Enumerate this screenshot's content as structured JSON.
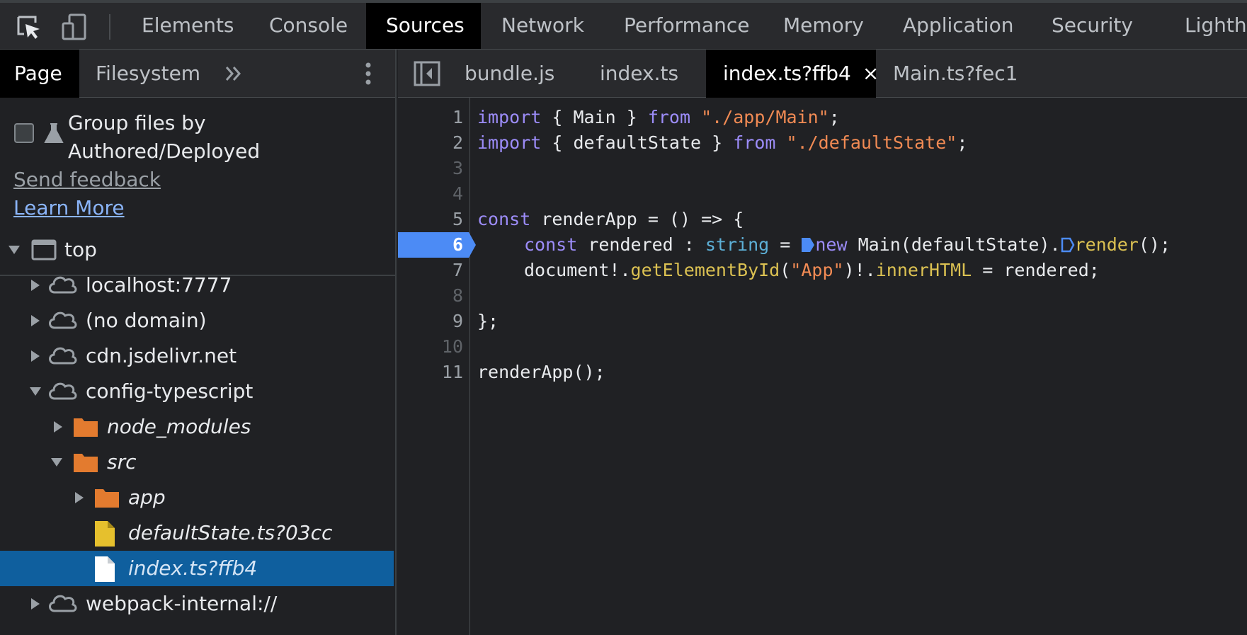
{
  "toolbar": {
    "tabs": [
      "Elements",
      "Console",
      "Sources",
      "Network",
      "Performance",
      "Memory",
      "Application",
      "Security",
      "Lighthouse"
    ],
    "icons": [
      "inspect-element-icon",
      "device-toolbar-icon"
    ]
  },
  "navigator": {
    "tabs": [
      "Page",
      "Filesystem"
    ],
    "group_label": "Group files by Authored/Deployed",
    "send_feedback": "Send feedback",
    "learn_more": "Learn More",
    "tree": {
      "top": "top",
      "localhost": "localhost:7777",
      "no_domain": "(no domain)",
      "cdn": "cdn.jsdelivr.net",
      "config": "config-typescript",
      "node_modules": "node_modules",
      "src": "src",
      "app": "app",
      "default_state": "defaultState.ts?03cc",
      "index": "index.ts?ffb4",
      "webpack": "webpack-internal://"
    }
  },
  "editor": {
    "tabs": [
      "bundle.js",
      "index.ts",
      "index.ts?ffb4",
      "Main.ts?fec1"
    ],
    "close_label": "×",
    "line_numbers": [
      "1",
      "2",
      "3",
      "4",
      "5",
      "6",
      "7",
      "8",
      "9",
      "10",
      "11"
    ],
    "breakpoint_line": "6",
    "code": {
      "l1": {
        "kw": "import",
        "a": " { Main } ",
        "kw2": "from",
        "str": " \"./app/Main\"",
        "b": ";"
      },
      "l2": {
        "kw": "import",
        "a": " { defaultState } ",
        "kw2": "from",
        "str": " \"./defaultState\"",
        "b": ";"
      },
      "l5": {
        "kw": "const",
        "a": " renderApp = () => {"
      },
      "l6": {
        "kw": "const",
        "a": " rendered : ",
        "typ": "string",
        "b": " = ",
        "kw2": "new",
        "c": " Main(defaultState).",
        "fn": "render",
        "d": "();"
      },
      "l7": {
        "a": "document!.",
        "fn": "getElementById",
        "b": "(",
        "str": "\"App\"",
        "c": ")!.",
        "fn2": "innerHTML",
        "d": " = rendered;"
      },
      "l9": "};",
      "l11": "renderApp();"
    }
  },
  "colors": {
    "keyword": "#9c8cf8",
    "string": "#f28b54",
    "type": "#5db0d7",
    "function": "#dbc152",
    "breakpoint": "#4c8bf5",
    "selection": "#0f5f9e"
  }
}
